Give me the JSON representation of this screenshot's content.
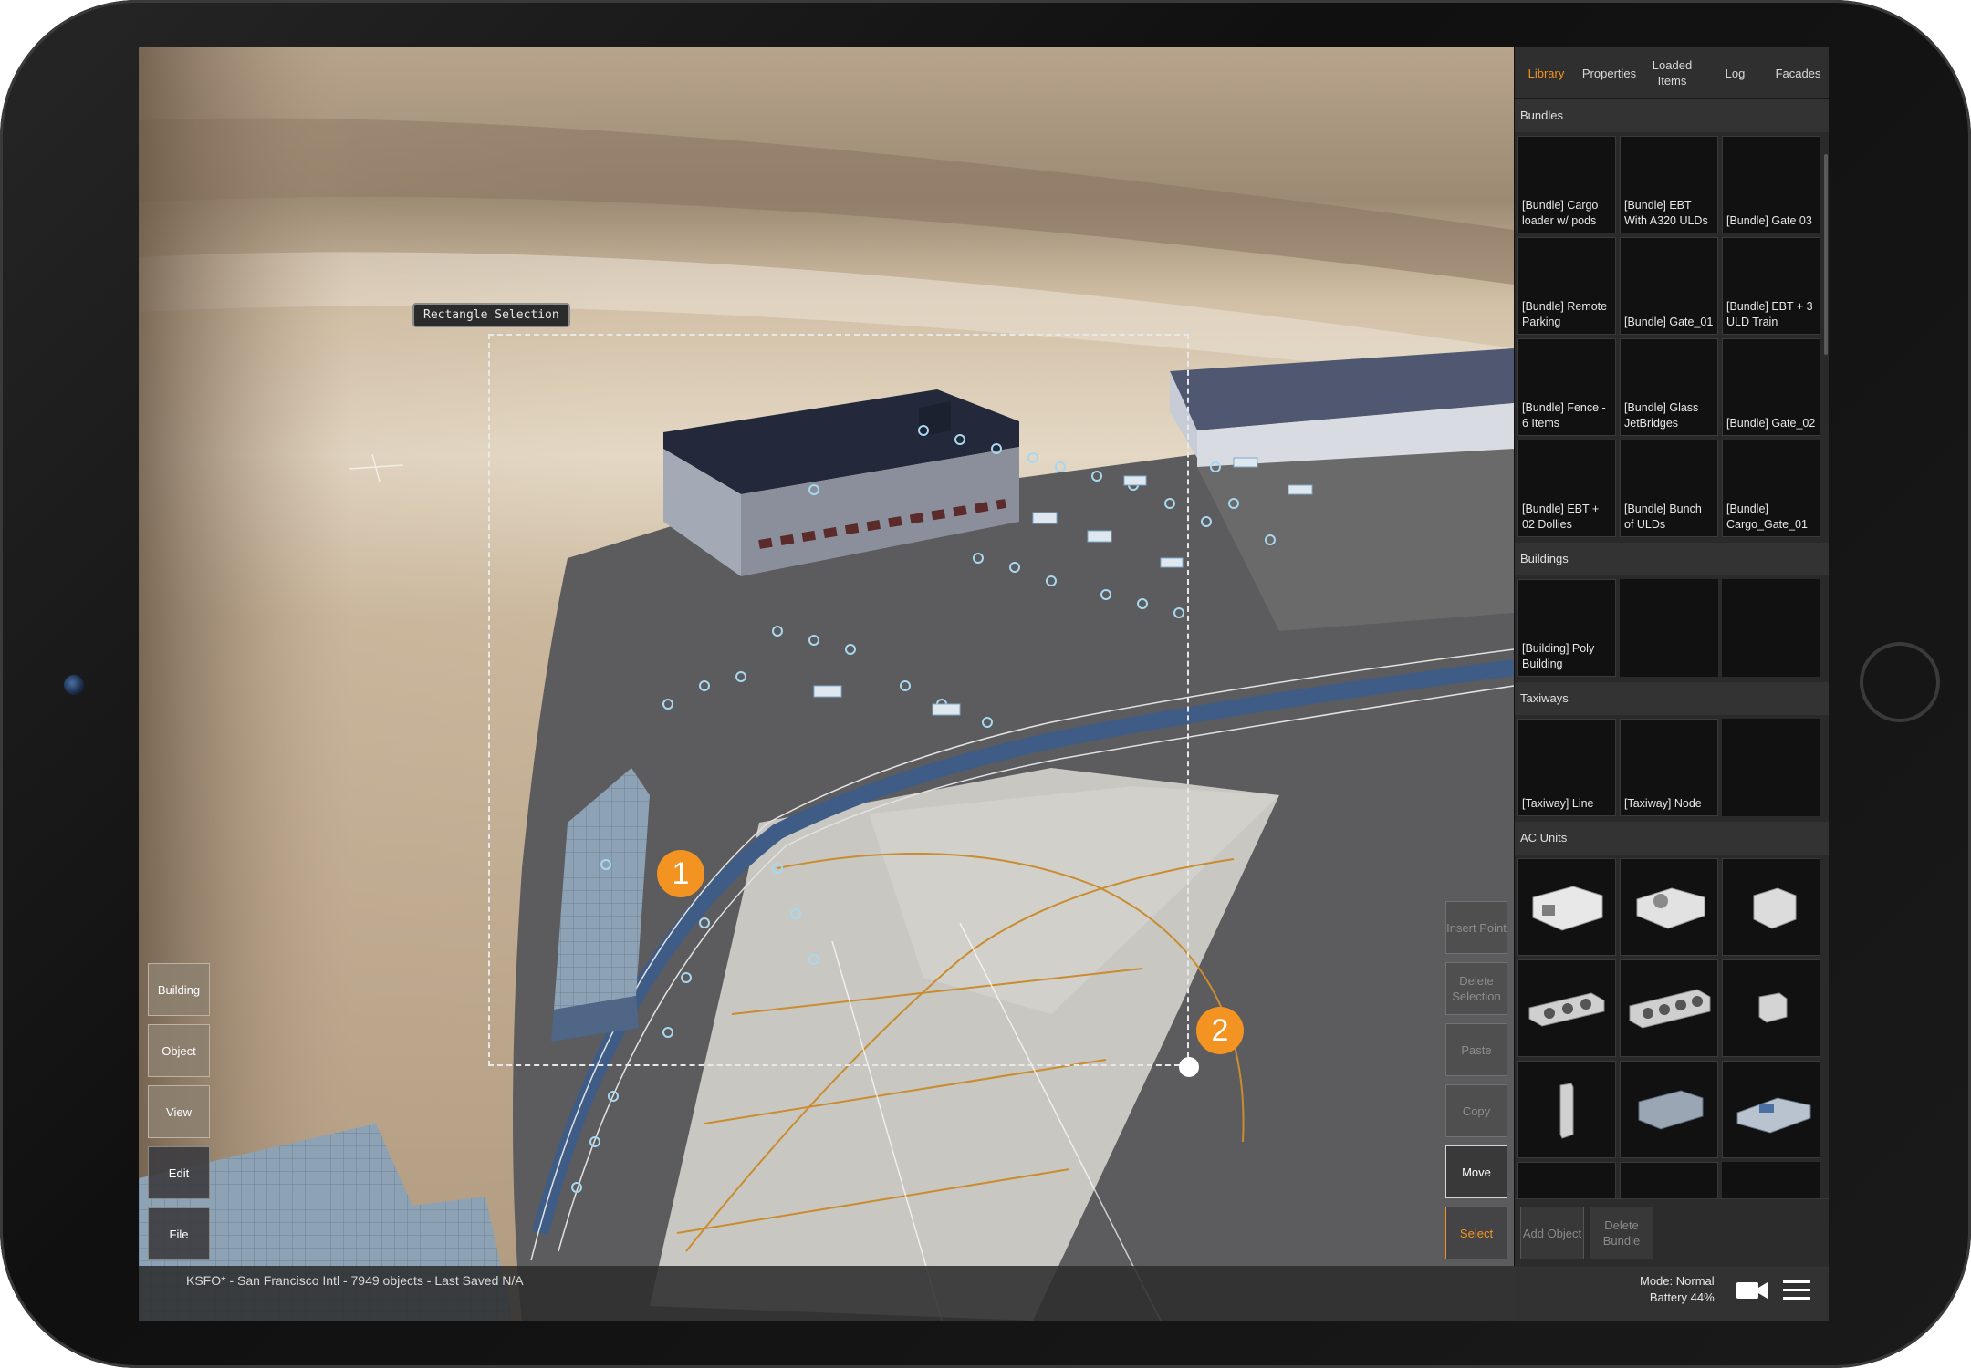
{
  "editor": {
    "selection_label": "Rectangle Selection",
    "markers": [
      "1",
      "2"
    ]
  },
  "left_tools": [
    "Building",
    "Object",
    "View",
    "Edit",
    "File"
  ],
  "right_tools": {
    "insert_point": "Insert Point",
    "delete_selection": "Delete Selection",
    "paste": "Paste",
    "copy": "Copy",
    "move": "Move",
    "select": "Select"
  },
  "status": {
    "text": "KSFO* - San Francisco Intl - 7949 objects - Last Saved N/A",
    "mode": "Mode: Normal",
    "battery": "Battery 44%"
  },
  "panel": {
    "tabs": [
      "Library",
      "Properties",
      "Loaded Items",
      "Log",
      "Facades"
    ],
    "active_tab": "Library",
    "sections": {
      "bundles": {
        "title": "Bundles",
        "items": [
          "[Bundle] Cargo loader w/ pods",
          "[Bundle] EBT With A320 ULDs",
          "[Bundle] Gate 03",
          "[Bundle] Remote Parking",
          "[Bundle] Gate_01",
          "[Bundle] EBT + 3 ULD Train",
          "[Bundle] Fence - 6 Items",
          "[Bundle] Glass JetBridges",
          "[Bundle] Gate_02",
          "[Bundle] EBT + 02 Dollies",
          "[Bundle] Bunch of ULDs",
          "[Bundle] Cargo_Gate_01"
        ]
      },
      "buildings": {
        "title": "Buildings",
        "items": [
          "[Building] Poly Building"
        ]
      },
      "taxiways": {
        "title": "Taxiways",
        "items": [
          "[Taxiway] Line",
          "[Taxiway] Node"
        ]
      },
      "ac_units": {
        "title": "AC Units"
      }
    },
    "footer": {
      "add_object": "Add Object",
      "delete_bundle": "Delete Bundle"
    }
  },
  "colors": {
    "accent": "#f39321",
    "panel_bg": "#2a2a2a"
  }
}
